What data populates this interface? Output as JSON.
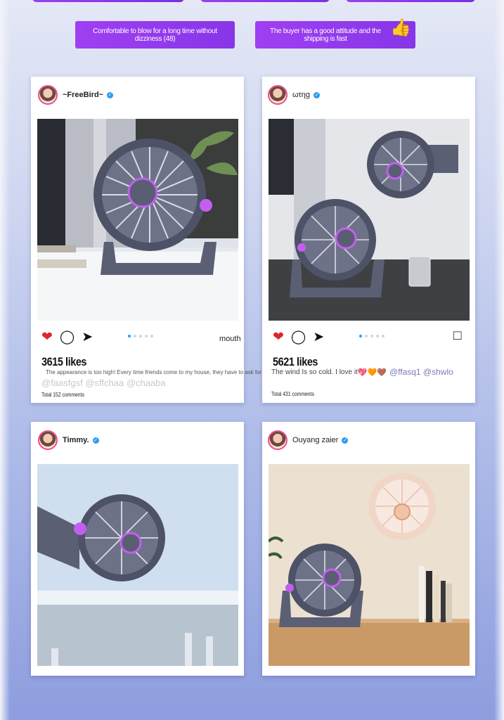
{
  "tags": {
    "left": "Comfortable to blow for a long time without dizziness (48)",
    "right": "The buyer has a good attitude and the shipping is fast"
  },
  "icons": {
    "thumb": "thumbs-up-icon",
    "heart": "heart-icon",
    "comment": "comment-icon",
    "share": "send-icon",
    "bookmark": "bookmark-icon",
    "verified": "verified-badge-icon"
  },
  "colors": {
    "accent": "#9b3ff0",
    "like": "#e0242c",
    "verified": "#2d9cf0"
  },
  "posts": [
    {
      "username": "~FreeBird~",
      "right_text": "mouth",
      "likes": "3615 likes",
      "caption": "The appearance is too high! Every time friends come to my house, they have to ask for the link!",
      "mentions": "@faasfgsf @sffchaa @chaaba",
      "comments": "Total 152 comments",
      "carousel_index": 1
    },
    {
      "username": "ωτηg",
      "likes": "5621 likes",
      "caption": "The wind Is so cold. I love it",
      "emoji": "💖🧡🤎",
      "mentions": "@ffasq1 @shwlo",
      "comments": "Total 431 comments",
      "carousel_index": 1
    },
    {
      "username": "Timmy."
    },
    {
      "username": "Ouyang zaier"
    }
  ]
}
